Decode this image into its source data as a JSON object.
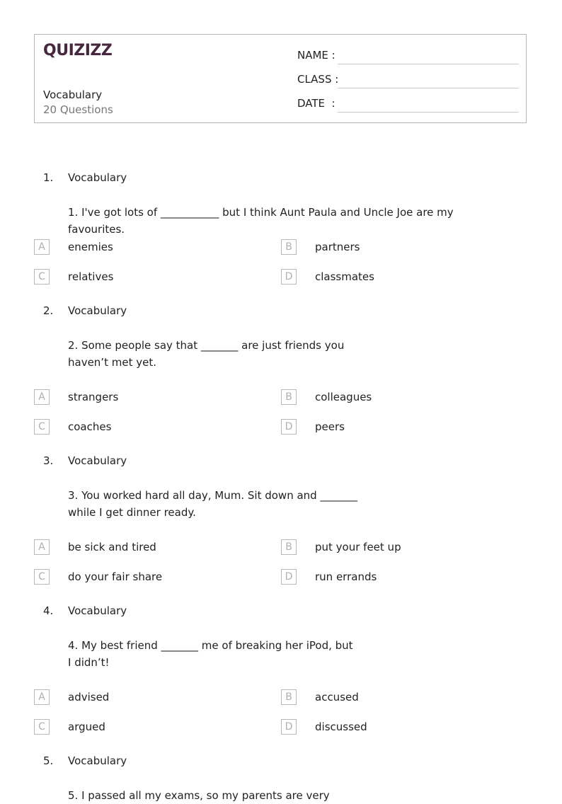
{
  "header": {
    "logo": "QUIZIZZ",
    "title": "Vocabulary",
    "subtitle": "20 Questions",
    "fields": [
      {
        "label": "NAME :"
      },
      {
        "label": "CLASS :"
      },
      {
        "label": "DATE  :"
      }
    ]
  },
  "questions": [
    {
      "number": "1.",
      "topic": "Vocabulary",
      "text": "1. I've got lots of ___________ but I think Aunt Paula and Uncle Joe are my favourites.",
      "options": [
        {
          "letter": "A",
          "text": "enemies"
        },
        {
          "letter": "B",
          "text": "partners"
        },
        {
          "letter": "C",
          "text": "relatives"
        },
        {
          "letter": "D",
          "text": "classmates"
        }
      ]
    },
    {
      "number": "2.",
      "topic": "Vocabulary",
      "text": "2. Some people say that _______ are just friends you haven’t met yet.",
      "options": [
        {
          "letter": "A",
          "text": "strangers"
        },
        {
          "letter": "B",
          "text": "colleagues"
        },
        {
          "letter": "C",
          "text": "coaches"
        },
        {
          "letter": "D",
          "text": "peers"
        }
      ]
    },
    {
      "number": "3.",
      "topic": "Vocabulary",
      "text": "3. You worked hard all day, Mum. Sit down and _______ while I get dinner ready.",
      "options": [
        {
          "letter": "A",
          "text": "be sick and tired"
        },
        {
          "letter": "B",
          "text": "put your feet up"
        },
        {
          "letter": "C",
          "text": "do your fair share"
        },
        {
          "letter": "D",
          "text": "run errands"
        }
      ]
    },
    {
      "number": "4.",
      "topic": "Vocabulary",
      "text": "4. My best friend _______ me of breaking her iPod, but I didn’t!",
      "options": [
        {
          "letter": "A",
          "text": "advised"
        },
        {
          "letter": "B",
          "text": "accused"
        },
        {
          "letter": "C",
          "text": "argued"
        },
        {
          "letter": "D",
          "text": "discussed"
        }
      ]
    },
    {
      "number": "5.",
      "topic": "Vocabulary",
      "text": "5. I passed all my exams, so my parents are very"
    }
  ]
}
